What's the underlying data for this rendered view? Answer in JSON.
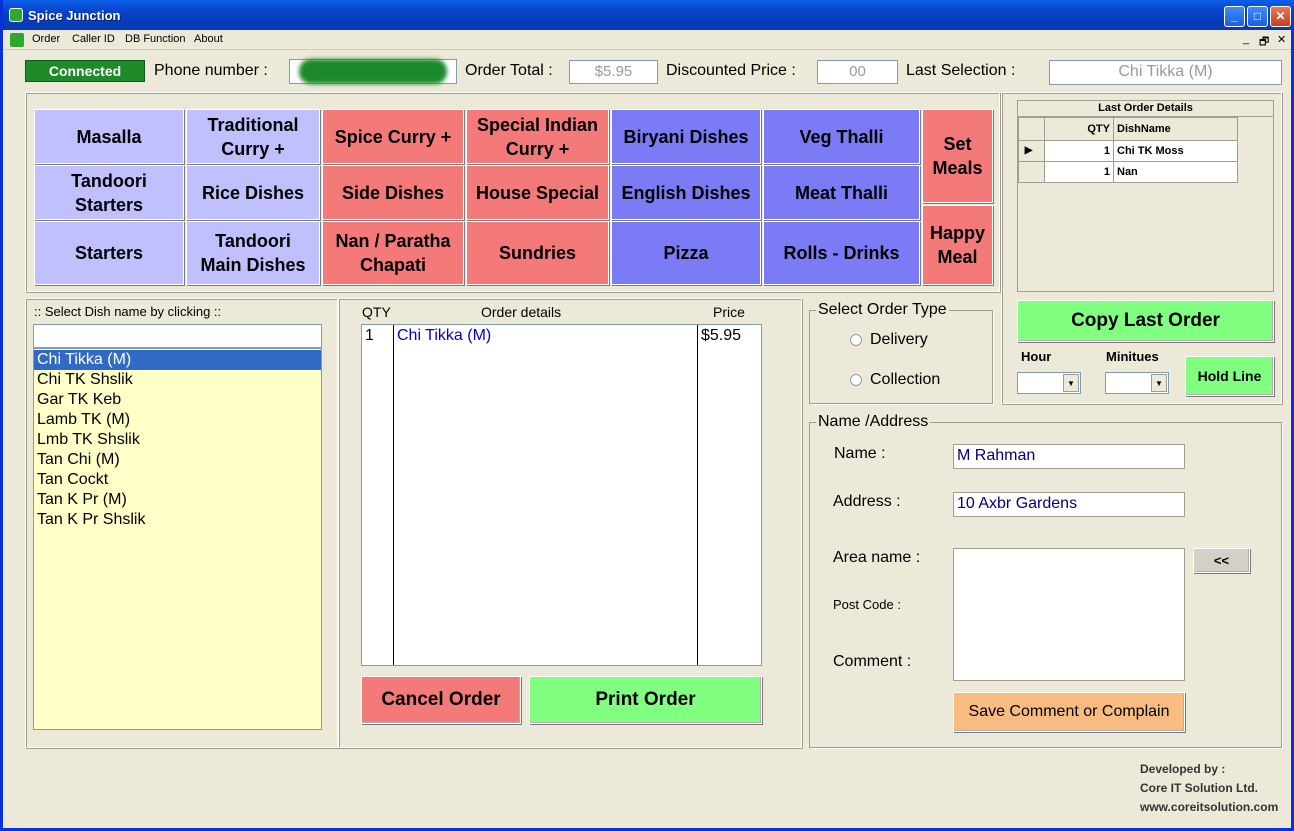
{
  "window": {
    "title": "Spice Junction",
    "min": "_",
    "max": "□",
    "close": "✕"
  },
  "menu": {
    "items": [
      "Order",
      "Caller ID",
      "DB Function",
      "About"
    ],
    "mdi_controls": [
      "_",
      "🗗",
      "✕"
    ]
  },
  "header": {
    "status": "Connected",
    "phone_label": "Phone number :",
    "order_total_label": "Order Total :",
    "order_total_value": "$5.95",
    "discount_label": "Discounted Price :",
    "discount_value": "00",
    "last_selection_label": "Last Selection :",
    "last_selection_value": "Chi Tikka (M)"
  },
  "categories": {
    "masalla": "Masalla",
    "traditional_curry": "Traditional Curry +",
    "spice_curry": "Spice Curry +",
    "special_indian_curry": "Special Indian Curry +",
    "biryani": "Biryani Dishes",
    "veg_thalli": "Veg Thalli",
    "set_meals": "Set Meals",
    "tandoori_starters": "Tandoori Starters",
    "rice": "Rice Dishes",
    "side": "Side Dishes",
    "house_special": "House Special",
    "english": "English Dishes",
    "meat_thalli": "Meat Thalli",
    "happy_meal": "Happy Meal",
    "starters": "Starters",
    "tandoori_main": "Tandoori Main Dishes",
    "nan_paratha": "Nan / Paratha Chapati",
    "sundries": "Sundries",
    "pizza": "Pizza",
    "rolls_drinks": "Rolls - Drinks"
  },
  "last_order": {
    "title": "Last Order Details",
    "col_qty": "QTY",
    "col_dish": "DishName",
    "rows": [
      {
        "qty": "1",
        "dish": "Chi TK Moss"
      },
      {
        "qty": "1",
        "dish": "Nan"
      }
    ]
  },
  "dish_list": {
    "title": ":: Select Dish name by clicking ::",
    "search": "",
    "items": [
      "Chi Tikka (M)",
      "Chi TK Shslik",
      "Gar TK Keb",
      "Lamb TK (M)",
      "Lmb TK Shslik",
      "Tan Chi (M)",
      "Tan Cockt",
      "Tan K Pr (M)",
      "Tan K Pr Shslik"
    ]
  },
  "order": {
    "col_qty": "QTY",
    "col_details": "Order details",
    "col_price": "Price",
    "rows": [
      {
        "qty": "1",
        "details": "Chi Tikka (M)",
        "price": "$5.95"
      }
    ],
    "cancel": "Cancel Order",
    "print": "Print Order"
  },
  "order_type": {
    "title": "Select Order Type",
    "delivery": "Delivery",
    "collection": "Collection"
  },
  "right_controls": {
    "copy_last": "Copy Last Order",
    "hour": "Hour",
    "minutes": "Minitues",
    "hold_line": "Hold Line"
  },
  "customer": {
    "title": "Name /Address",
    "name_label": "Name :",
    "name_value": "M Rahman",
    "address_label": "Address :",
    "address_value": "10 Axbr Gardens",
    "area_label": "Area name :",
    "postcode_label": "Post Code :",
    "comment_label": "Comment :",
    "back_button": "<<",
    "save_comment": "Save Comment or Complain"
  },
  "credits": {
    "line1": "Developed by :",
    "line2": "Core IT Solution Ltd.",
    "line3": "www.coreitsolution.com"
  },
  "colors": {
    "lavender": "#c0c0ff",
    "salmon": "#f47a7a",
    "blue": "#7b7bf5",
    "green": "#80ff80",
    "orange": "#f8bb80",
    "connected": "#1f8a2a"
  }
}
